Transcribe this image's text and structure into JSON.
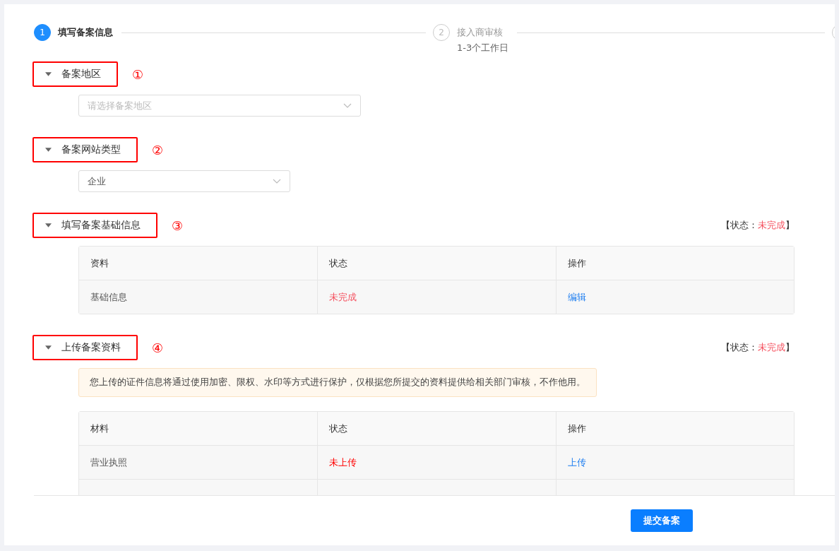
{
  "steps": [
    {
      "number": "1",
      "title": "填写备案信息",
      "active": true
    },
    {
      "number": "2",
      "title": "接入商审核",
      "subtitle": "1-3个工作日",
      "active": false
    },
    {
      "active": false
    }
  ],
  "sections": [
    {
      "kind": "select",
      "title": "备案地区",
      "marker": "①",
      "expanded": true,
      "field": {
        "placeholder": "请选择备案地区"
      },
      "wide": true
    },
    {
      "kind": "select",
      "title": "备案网站类型",
      "marker": "②",
      "expanded": true,
      "field": {
        "value": "企业"
      },
      "wide": false
    },
    {
      "kind": "table",
      "title": "填写备案基础信息",
      "marker": "③",
      "expanded": true,
      "status": {
        "prefix": "【状态：",
        "value": "未完成",
        "suffix": "】"
      },
      "table": {
        "columns": [
          "资料",
          "状态",
          "操作"
        ],
        "rows": [
          [
            {
              "kind": "text",
              "text": "基础信息"
            },
            {
              "kind": "status",
              "text": "未完成",
              "color": "#f5515f"
            },
            {
              "kind": "link",
              "text": "编辑"
            }
          ]
        ]
      }
    },
    {
      "kind": "table",
      "title": "上传备案资料",
      "marker": "④",
      "expanded": true,
      "status": {
        "prefix": "【状态：",
        "value": "未完成",
        "suffix": "】"
      },
      "notice": "您上传的证件信息将通过使用加密、限权、水印等方式进行保护，仅根据您所提交的资料提供给相关部门审核，不作他用。",
      "table": {
        "columns": [
          "材料",
          "状态",
          "操作"
        ],
        "rows": [
          [
            {
              "kind": "text",
              "text": "营业执照"
            },
            {
              "kind": "status",
              "text": "未上传",
              "color": "#ff0000"
            },
            {
              "kind": "link",
              "text": "上传"
            }
          ],
          [
            {
              "kind": "text",
              "text": ""
            },
            {
              "kind": "text",
              "text": ""
            },
            {
              "kind": "text",
              "text": ""
            }
          ]
        ]
      }
    }
  ],
  "footer": {
    "submit": "提交备案"
  }
}
